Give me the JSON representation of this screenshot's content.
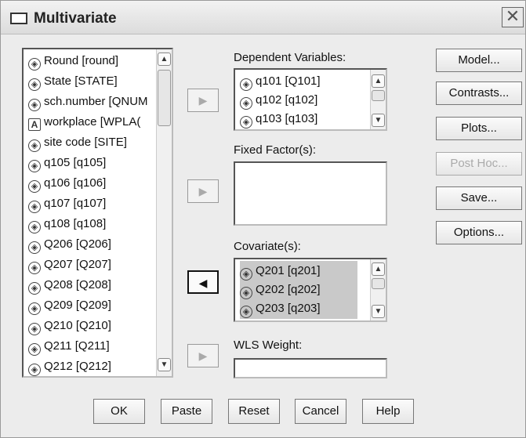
{
  "window": {
    "title": "Multivariate",
    "close_glyph": "✕"
  },
  "source_list": {
    "items": [
      {
        "label": "Round [round]",
        "icon": "scale-icon"
      },
      {
        "label": "State [STATE]",
        "icon": "scale-icon"
      },
      {
        "label": "sch.number [QNUM",
        "icon": "scale-icon"
      },
      {
        "label": "workplace [WPLA(",
        "icon": "nominal-icon"
      },
      {
        "label": "site code [SITE]",
        "icon": "scale-icon"
      },
      {
        "label": "q105 [q105]",
        "icon": "scale-icon"
      },
      {
        "label": "q106 [q106]",
        "icon": "scale-icon"
      },
      {
        "label": "q107 [q107]",
        "icon": "scale-icon"
      },
      {
        "label": "q108 [q108]",
        "icon": "scale-icon"
      },
      {
        "label": "Q206 [Q206]",
        "icon": "scale-icon"
      },
      {
        "label": "Q207 [Q207]",
        "icon": "scale-icon"
      },
      {
        "label": "Q208 [Q208]",
        "icon": "scale-icon"
      },
      {
        "label": "Q209 [Q209]",
        "icon": "scale-icon"
      },
      {
        "label": "Q210 [Q210]",
        "icon": "scale-icon"
      },
      {
        "label": "Q211 [Q211]",
        "icon": "scale-icon"
      },
      {
        "label": "Q212 [Q212]",
        "icon": "scale-icon"
      }
    ]
  },
  "dependent": {
    "label": "Dependent Variables:",
    "items": [
      "q101 [Q101]",
      "q102 [q102]",
      "q103 [q103]"
    ]
  },
  "fixed_factors": {
    "label": "Fixed Factor(s):"
  },
  "covariates": {
    "label": "Covariate(s):",
    "items": [
      "Q201 [q201]",
      "Q202 [q202]",
      "Q203 [q203]"
    ]
  },
  "wls": {
    "label": "WLS Weight:",
    "value": ""
  },
  "arrows": {
    "right": "▶",
    "left": "◀"
  },
  "side_buttons": {
    "model": "Model...",
    "contrasts": "Contrasts...",
    "plots": "Plots...",
    "post_hoc": "Post Hoc...",
    "save": "Save...",
    "options": "Options..."
  },
  "bottom_buttons": {
    "ok": "OK",
    "paste": "Paste",
    "reset": "Reset",
    "cancel": "Cancel",
    "help": "Help"
  },
  "icons": {
    "scale": "◈",
    "nominal": "A",
    "up": "▲",
    "down": "▼"
  }
}
